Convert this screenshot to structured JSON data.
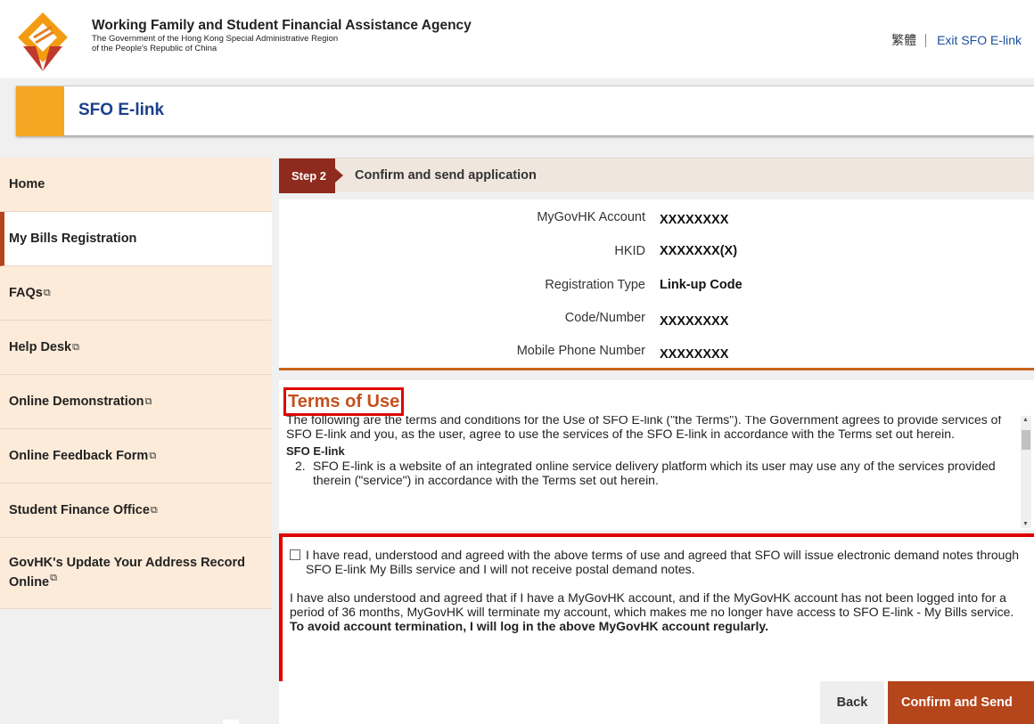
{
  "header": {
    "agency_title": "Working Family and Student Financial Assistance Agency",
    "agency_sub_line1": "The Government of the Hong Kong Special Administrative Region",
    "agency_sub_line2": "of the People's Republic of China",
    "lang_link": "繁體",
    "exit_link": "Exit SFO E-link",
    "logo_icon": "sfo-logo"
  },
  "titlebar": {
    "title": "SFO E-link"
  },
  "sidebar": {
    "items": [
      {
        "label": "Home",
        "external": false
      },
      {
        "label": "My Bills Registration",
        "external": false
      },
      {
        "label": "FAQs",
        "external": true
      },
      {
        "label": "Help Desk",
        "external": true
      },
      {
        "label": "Online Demonstration",
        "external": true
      },
      {
        "label": "Online Feedback Form",
        "external": true
      },
      {
        "label": "Student Finance Office",
        "external": true
      },
      {
        "label": "GovHK's Update Your Address Record Online",
        "external": true
      }
    ],
    "external_icon": "⧉"
  },
  "step": {
    "number": "Step 2",
    "title": "Confirm and send application"
  },
  "details": [
    {
      "label": "MyGovHK Account",
      "value": "XXXXXXXX"
    },
    {
      "label": "HKID",
      "value": "XXXXXXX(X)"
    },
    {
      "label": "Registration Type",
      "value": "Link-up Code"
    },
    {
      "label": "Code/Number",
      "value": "XXXXXXXX"
    },
    {
      "label": "Mobile Phone Number",
      "value": "XXXXXXXX"
    }
  ],
  "terms": {
    "title": "Terms of Use",
    "para1": "The following are the terms and conditions for the Use of SFO E-link (\"the Terms\"). The Government agrees to provide services of SFO E-link and you, as the user, agree to use the services of the SFO E-link in accordance with the Terms set out herein.",
    "subhead": "SFO E-link",
    "item_num": "2.",
    "item_text": "SFO E-link is a website of an integrated online service delivery platform which its user may use any of the services provided therein (\"service\") in accordance with the Terms set out herein."
  },
  "agreement": {
    "text1": "I have read, understood and agreed with the above terms of use and agreed that SFO will issue electronic demand notes through SFO E-link My Bills service and I will not receive postal demand notes.",
    "text2": "I have also understood and agreed that if I have a MyGovHK account, and if the MyGovHK account has not been logged into for a period of 36 months, MyGovHK will terminate my account, which makes me no longer have access to SFO E-link - My Bills service.",
    "text2_bold": "To avoid account termination, I will log in the above MyGovHK account regularly."
  },
  "actions": {
    "back": "Back",
    "confirm": "Confirm and Send"
  },
  "colors": {
    "accent": "#f5a623",
    "brand_red": "#b5451b",
    "highlight": "#e00000",
    "title_blue": "#1a3f8c"
  }
}
